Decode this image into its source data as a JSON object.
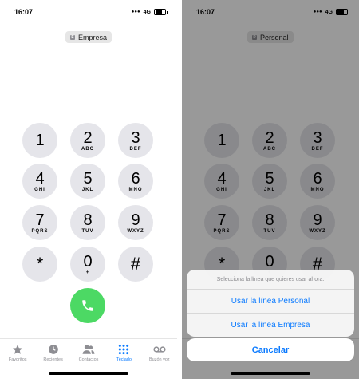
{
  "status": {
    "time": "16:07",
    "network": "4G"
  },
  "left": {
    "line": "Empresa",
    "line_icon": "E"
  },
  "right": {
    "line": "Personal",
    "line_icon": "P"
  },
  "keypad": [
    {
      "digit": "1",
      "letters": ""
    },
    {
      "digit": "2",
      "letters": "ABC"
    },
    {
      "digit": "3",
      "letters": "DEF"
    },
    {
      "digit": "4",
      "letters": "GHI"
    },
    {
      "digit": "5",
      "letters": "JKL"
    },
    {
      "digit": "6",
      "letters": "MNO"
    },
    {
      "digit": "7",
      "letters": "PQRS"
    },
    {
      "digit": "8",
      "letters": "TUV"
    },
    {
      "digit": "9",
      "letters": "WXYZ"
    },
    {
      "digit": "*",
      "letters": ""
    },
    {
      "digit": "0",
      "letters": "+"
    },
    {
      "digit": "#",
      "letters": ""
    }
  ],
  "tabs": [
    {
      "label": "Favoritos",
      "icon": "star-icon"
    },
    {
      "label": "Recientes",
      "icon": "clock-icon"
    },
    {
      "label": "Contactos",
      "icon": "contacts-icon"
    },
    {
      "label": "Teclado",
      "icon": "keypad-icon",
      "active": true
    },
    {
      "label": "Buzón voz",
      "icon": "voicemail-icon"
    }
  ],
  "sheet": {
    "message": "Selecciona la línea que quieres usar ahora.",
    "option1": "Usar la línea Personal",
    "option2": "Usar la línea Empresa",
    "cancel": "Cancelar"
  },
  "colors": {
    "accent": "#0a7aff",
    "call": "#4cd964",
    "key": "#e5e5ea"
  }
}
